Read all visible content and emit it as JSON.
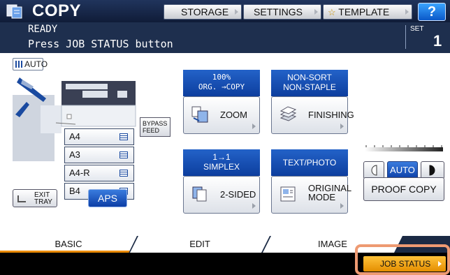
{
  "header": {
    "title": "COPY",
    "storage_label": "STORAGE",
    "settings_label": "SETTINGS",
    "template_label": "TEMPLATE",
    "help_label": "?"
  },
  "status": {
    "line1": "READY",
    "line2": "Press JOB STATUS button",
    "set_label": "SET",
    "set_value": "1"
  },
  "paper": {
    "auto_label": "AUTO",
    "bypass_label_1": "BYPASS",
    "bypass_label_2": "FEED",
    "trays": [
      "A4",
      "A3",
      "A4-R",
      "B4"
    ],
    "exit_tray_1": "EXIT",
    "exit_tray_2": "TRAY",
    "aps_label": "APS"
  },
  "functions": {
    "zoom_header_1": "100%",
    "zoom_header_2": "ORG. →COPY",
    "zoom_label": "ZOOM",
    "finishing_header_1": "NON-SORT",
    "finishing_header_2": "NON-STAPLE",
    "finishing_label": "FINISHING",
    "sided_header_1": "1→1",
    "sided_header_2": "SIMPLEX",
    "sided_label": "2-SIDED",
    "mode_header": "TEXT/PHOTO",
    "mode_label_1": "ORIGINAL",
    "mode_label_2": "MODE"
  },
  "density": {
    "auto_label": "AUTO",
    "proof_copy_label": "PROOF COPY"
  },
  "tabs": [
    "BASIC",
    "EDIT",
    "IMAGE"
  ],
  "job_status_label": "JOB STATUS",
  "colors": {
    "accent_blue": "#0d3e9e",
    "job_status_orange": "#f0a020",
    "highlight": "#ee9a72"
  }
}
